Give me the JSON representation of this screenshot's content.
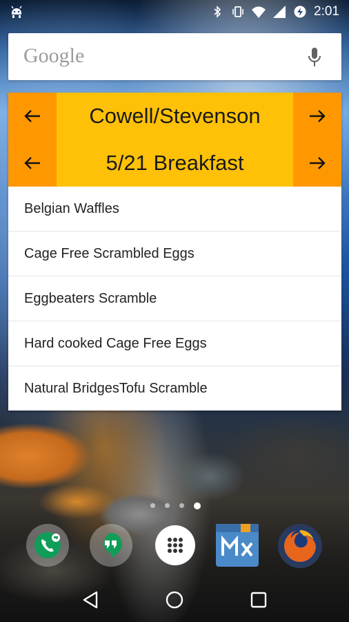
{
  "status_bar": {
    "time": "2:01",
    "icons": [
      "android-debug-icon",
      "bluetooth-icon",
      "vibrate-icon",
      "wifi-icon",
      "cell-signal-icon",
      "data-saver-icon"
    ]
  },
  "search": {
    "logo": "Google",
    "icon": "mic-icon"
  },
  "widget": {
    "hall": "Cowell/Stevenson",
    "meal": "5/21 Breakfast",
    "prev_icon": "arrow-left-icon",
    "next_icon": "arrow-right-icon",
    "menu_items": [
      "Belgian Waffles",
      "Cage Free Scrambled Eggs",
      "Eggbeaters Scramble",
      "Hard cooked Cage Free Eggs",
      "Natural BridgesTofu Scramble"
    ],
    "colors": {
      "row_bg": "#ffc107",
      "arrow_bg": "#ff9800"
    }
  },
  "home": {
    "page_count": 4,
    "active_page": 4,
    "dock": [
      "hangouts-dialer-icon",
      "hangouts-icon",
      "app-drawer-icon",
      "x-media-icon",
      "firefox-icon"
    ]
  },
  "nav": [
    "back-icon",
    "home-icon",
    "recents-icon"
  ]
}
